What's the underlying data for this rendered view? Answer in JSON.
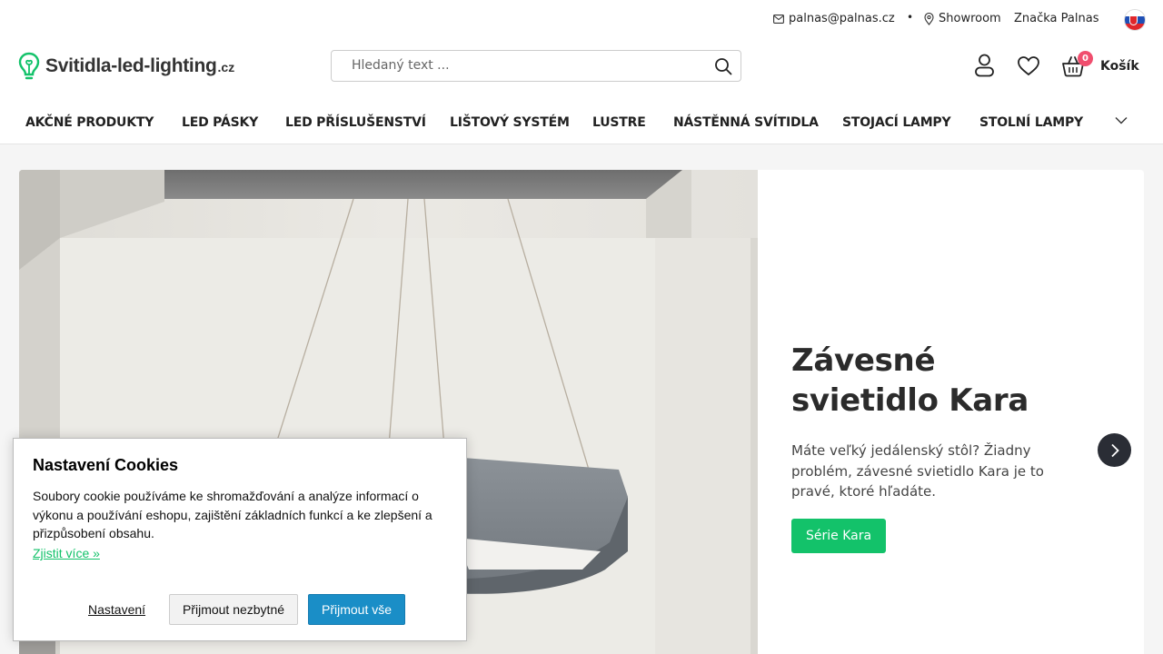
{
  "topbar": {
    "email": "palnas@palnas.cz",
    "separator": "•",
    "showroom": "Showroom",
    "brand_link": "Značka Palnas",
    "language_flag": "slovakia-flag"
  },
  "header": {
    "logo_text": "Svitidla-led-lighting",
    "logo_tld": ".cz",
    "search_placeholder": "Hledaný text ...",
    "cart_count": "0",
    "cart_label": "Košík"
  },
  "nav": {
    "items": [
      "AKČNÉ PRODUKTY",
      "LED PÁSKY",
      "LED PŘÍSLUŠENSTVÍ",
      "LIŠTOVÝ SYSTÉM",
      "LUSTRE",
      "NÁSTĚNNÁ SVÍTIDLA",
      "STOJACÍ LAMPY",
      "STOLNÍ LAMPY"
    ]
  },
  "hero": {
    "title": "Závesné svietidlo Kara",
    "description": "Máte veľký jedálenský stôl? Žiadny problém, závesné svietidlo Kara je to pravé, ktoré hľadáte.",
    "button": "Série Kara"
  },
  "cookie": {
    "title": "Nastavení Cookies",
    "text": "Soubory cookie používáme ke shromažďování a analýze informací o výkonu a používání eshopu, zajištění základních funkcí a ke zlepšení a přizpůsobení obsahu.",
    "learn_more": "Zjistit více »",
    "settings": "Nastavení",
    "accept_necessary": "Přijmout nezbytné",
    "accept_all": "Přijmout vše"
  },
  "colors": {
    "accent_green": "#13c26a",
    "cookie_blue": "#1a8ec7",
    "badge_pink": "#f04e6e"
  }
}
